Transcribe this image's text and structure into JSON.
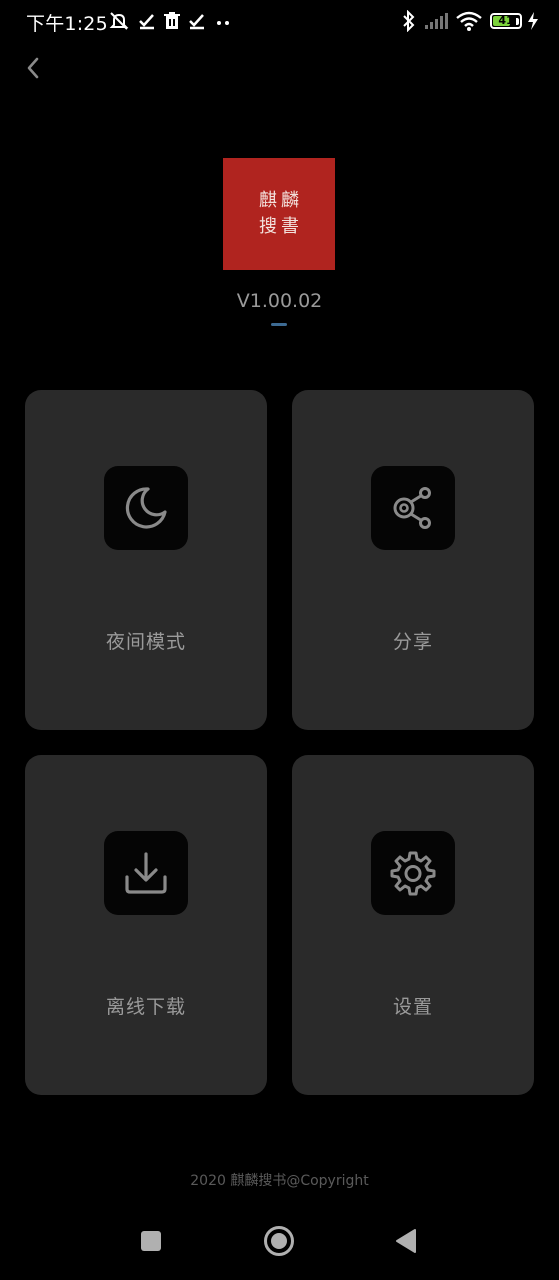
{
  "status_bar": {
    "time": "下午1:25",
    "battery_level": "41",
    "icons_left": [
      "mute-icon",
      "check-icon",
      "trash-icon",
      "check-icon",
      "more-dots-icon"
    ],
    "icons_right": [
      "bluetooth-icon",
      "signal-icon",
      "wifi-icon",
      "battery-icon",
      "charging-icon"
    ]
  },
  "header": {
    "back_icon": "chevron-left-icon"
  },
  "app": {
    "logo_chars": [
      "麒",
      "麟",
      "搜",
      "書"
    ],
    "logo_color": "#b0241f",
    "version": "V1.00.02",
    "accent": "#3d6b93"
  },
  "cards": [
    {
      "label": "夜间模式",
      "icon": "moon-icon"
    },
    {
      "label": "分享",
      "icon": "share-icon"
    },
    {
      "label": "离线下载",
      "icon": "download-icon"
    },
    {
      "label": "设置",
      "icon": "gear-icon"
    }
  ],
  "footer": {
    "copyright": "2020 麒麟搜书@Copyright"
  },
  "nav_bar": {
    "buttons": [
      "recents-square-icon",
      "home-circle-icon",
      "back-triangle-icon"
    ]
  }
}
